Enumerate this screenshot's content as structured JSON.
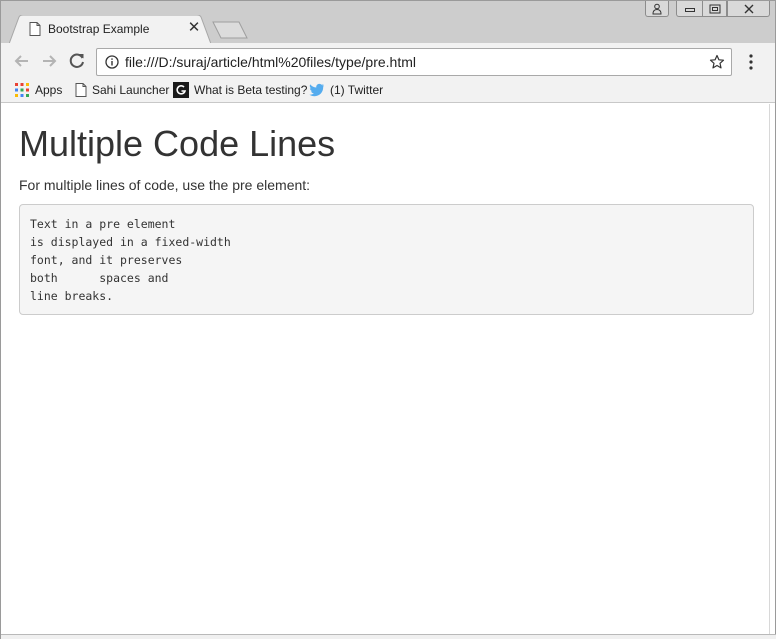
{
  "browser": {
    "tab_title": "Bootstrap Example",
    "url": "file:///D:/suraj/article/html%20files/type/pre.html",
    "bookmarks": [
      {
        "label": "Apps",
        "icon": "apps-grid-icon"
      },
      {
        "label": "Sahi Launcher",
        "icon": "page-icon"
      },
      {
        "label": "What is Beta testing?",
        "icon": "g-logo-icon"
      },
      {
        "label": "(1) Twitter",
        "icon": "twitter-bird-icon"
      }
    ],
    "colors": {
      "titlebar": "#cdcdcd",
      "toolbar": "#f2f2f2",
      "twitter": "#55acee"
    }
  },
  "page": {
    "heading": "Multiple Code Lines",
    "intro": "For multiple lines of code, use the pre element:",
    "pre_text": "Text in a pre element\nis displayed in a fixed-width\nfont, and it preserves\nboth      spaces and\nline breaks."
  }
}
